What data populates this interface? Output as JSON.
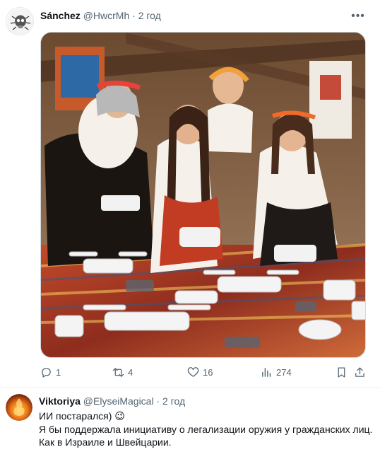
{
  "post": {
    "author_name": "Sánchez",
    "author_handle": "@HwcrMh",
    "separator": "·",
    "time": "2 год",
    "more_label": "•••",
    "media_icon": "image-photo",
    "actions": {
      "replies": "1",
      "retweets": "4",
      "likes": "16",
      "views": "274"
    }
  },
  "reply": {
    "author_name": "Viktoriya",
    "author_handle": "@ElyseiMagical",
    "separator": "·",
    "time": "2 год",
    "lines": [
      "ИИ постарался) 😉",
      "Я бы поддержала инициативу о легализации оружия у гражданских лиц.",
      "Как в Израиле и Швейцарии."
    ]
  },
  "colors": {
    "text": "#0f1419",
    "secondary": "#536471",
    "border": "#eff3f4"
  }
}
